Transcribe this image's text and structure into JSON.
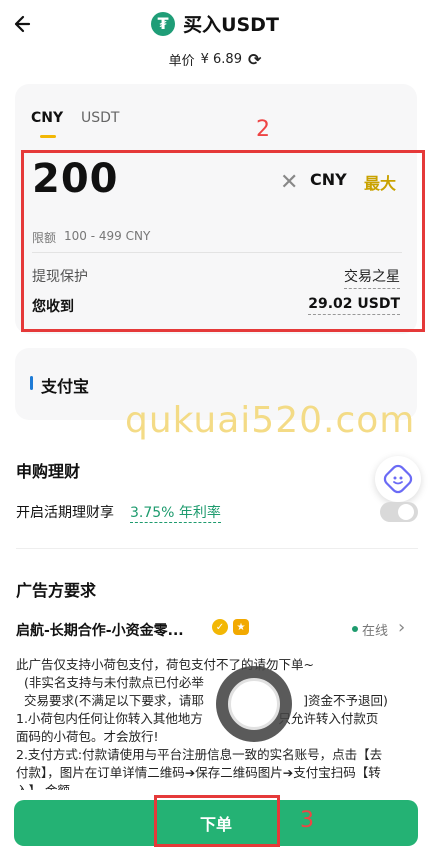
{
  "header": {
    "title": "买入USDT",
    "price_label": "单价",
    "price_value": "¥ 6.89"
  },
  "tabs": [
    "CNY",
    "USDT"
  ],
  "annotations": {
    "box2": "2",
    "box3": "3"
  },
  "amount": {
    "value": "200",
    "currency": "CNY",
    "max_label": "最大",
    "limit_label": "限额",
    "limit_range": "100 - 499 CNY"
  },
  "protection": {
    "label": "提现保护",
    "value": "交易之星"
  },
  "receive": {
    "label": "您收到",
    "value": "29.02 USDT"
  },
  "payment": {
    "method": "支付宝"
  },
  "watermark": "qukuai520.com",
  "wealth": {
    "section_title": "申购理财",
    "label": "开启活期理财享",
    "rate": "3.75% 年利率",
    "toggle_on": false
  },
  "ad": {
    "section_title": "广告方要求",
    "seller": "启航-长期合作-小资金零...",
    "status": "在线",
    "lines": [
      "此广告仅支持小荷包支付，荷包支付不了的请勿下单~",
      "  (非实名支持与未付款点已付必举",
      "  交易要求(不满足以下要求，请耶                         ]资金不予退回)",
      "1.小荷包内任何让你转入其他地方                   只允许转入付款页",
      "面码的小荷包。才会放行!",
      "2.支付方式:付款请使用与平台注册信息一致的实名账号，点击【去",
      "付款】，图片在订单详情二维码➔保存二维码图片➔支付宝扫码【转",
      "入】 金额"
    ]
  },
  "order_button": "下单",
  "colors": {
    "brand_green": "#24b274",
    "accent_yellow": "#f2b705",
    "annotation_red": "#e53939"
  }
}
